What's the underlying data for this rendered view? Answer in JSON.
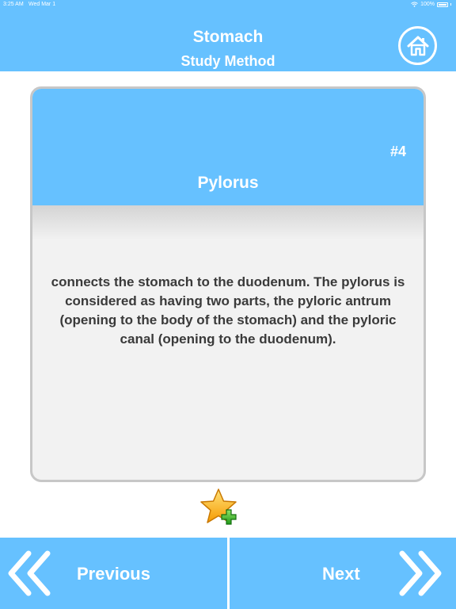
{
  "status_bar": {
    "time": "3:25 AM",
    "date": "Wed Mar 1",
    "battery": "100%"
  },
  "header": {
    "title": "Stomach",
    "subtitle": "Study Method",
    "home_icon": "home-icon"
  },
  "card": {
    "number": "#4",
    "term": "Pylorus",
    "definition": "connects the stomach to the duodenum. The pylorus is considered as having two parts, the pyloric antrum (opening to the body of the stomach) and the pyloric canal (opening to the duodenum)."
  },
  "favorite": {
    "icon": "star-add-icon"
  },
  "footer": {
    "previous_label": "Previous",
    "next_label": "Next"
  },
  "colors": {
    "accent": "#66c1ff",
    "card_background": "#f2f2f2",
    "card_border": "#c7c7c7",
    "text": "#3a3a3a"
  }
}
